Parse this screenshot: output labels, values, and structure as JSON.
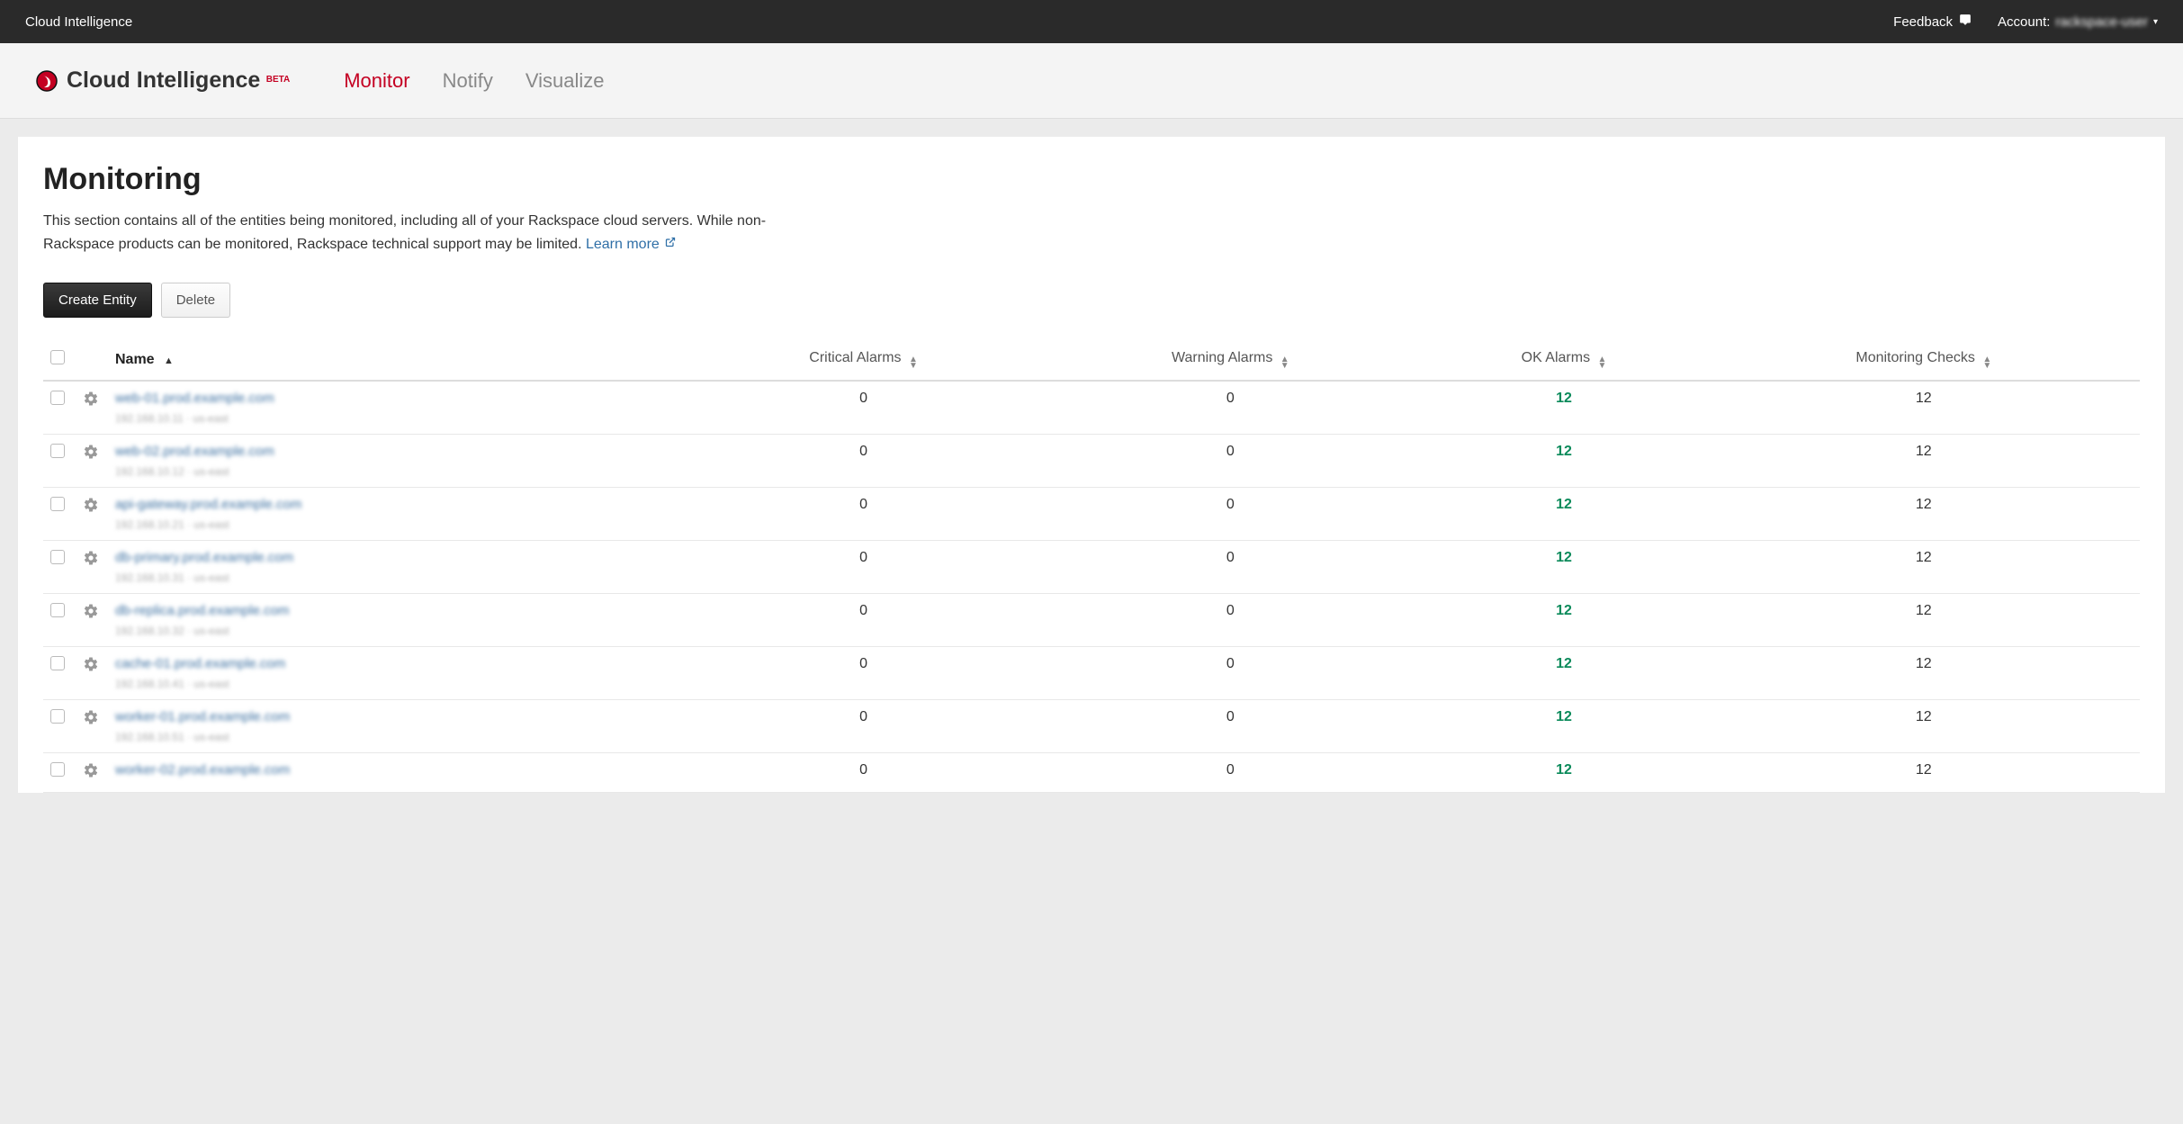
{
  "topbar": {
    "brand": "Cloud Intelligence",
    "feedback": "Feedback",
    "account_label": "Account:",
    "account_value": "rackspace-user"
  },
  "subheader": {
    "brand": "Cloud Intelligence",
    "beta": "BETA",
    "tabs": {
      "monitor": "Monitor",
      "notify": "Notify",
      "visualize": "Visualize"
    }
  },
  "page": {
    "title": "Monitoring",
    "desc": "This section contains all of the entities being monitored, including all of your Rackspace cloud servers. While non-Rackspace products can be monitored, Rackspace technical support may be limited. ",
    "learn_more": "Learn more"
  },
  "buttons": {
    "create": "Create Entity",
    "delete": "Delete"
  },
  "table": {
    "headers": {
      "name": "Name",
      "critical": "Critical Alarms",
      "warning": "Warning Alarms",
      "ok": "OK Alarms",
      "checks": "Monitoring Checks"
    },
    "rows": [
      {
        "name": "web-01.prod.example.com",
        "sub": "192.168.10.11 · us-east",
        "critical": "0",
        "warning": "0",
        "ok": "12",
        "checks": "12"
      },
      {
        "name": "web-02.prod.example.com",
        "sub": "192.168.10.12 · us-east",
        "critical": "0",
        "warning": "0",
        "ok": "12",
        "checks": "12"
      },
      {
        "name": "api-gateway.prod.example.com",
        "sub": "192.168.10.21 · us-east",
        "critical": "0",
        "warning": "0",
        "ok": "12",
        "checks": "12"
      },
      {
        "name": "db-primary.prod.example.com",
        "sub": "192.168.10.31 · us-east",
        "critical": "0",
        "warning": "0",
        "ok": "12",
        "checks": "12"
      },
      {
        "name": "db-replica.prod.example.com",
        "sub": "192.168.10.32 · us-east",
        "critical": "0",
        "warning": "0",
        "ok": "12",
        "checks": "12"
      },
      {
        "name": "cache-01.prod.example.com",
        "sub": "192.168.10.41 · us-east",
        "critical": "0",
        "warning": "0",
        "ok": "12",
        "checks": "12"
      },
      {
        "name": "worker-01.prod.example.com",
        "sub": "192.168.10.51 · us-east",
        "critical": "0",
        "warning": "0",
        "ok": "12",
        "checks": "12"
      },
      {
        "name": "worker-02.prod.example.com",
        "sub": "",
        "critical": "0",
        "warning": "0",
        "ok": "12",
        "checks": "12"
      }
    ]
  }
}
